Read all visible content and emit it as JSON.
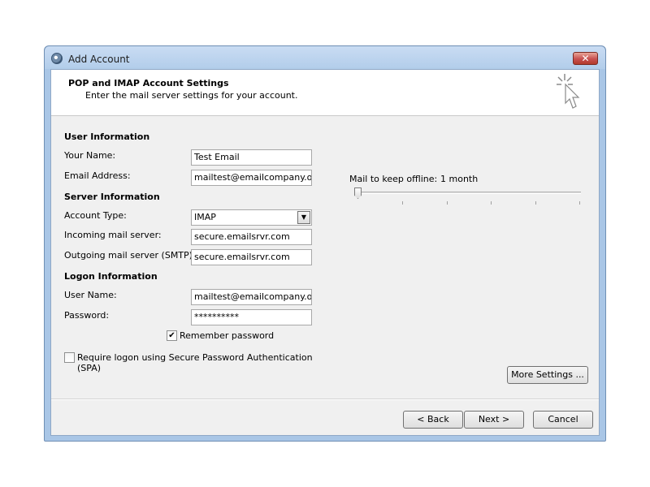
{
  "window": {
    "title": "Add Account",
    "close_glyph": "✕"
  },
  "header": {
    "title": "POP and IMAP Account Settings",
    "subtitle": "Enter the mail server settings for your account.",
    "icon": "cursor-sparkle-icon"
  },
  "user_info": {
    "heading": "User Information",
    "name_label": "Your Name:",
    "name_value": "Test Email",
    "email_label": "Email Address:",
    "email_value": "mailtest@emailcompany.org"
  },
  "server_info": {
    "heading": "Server Information",
    "account_type_label": "Account Type:",
    "account_type_value": "IMAP",
    "incoming_label": "Incoming mail server:",
    "incoming_value": "secure.emailsrvr.com",
    "outgoing_label": "Outgoing mail server (SMTP):",
    "outgoing_value": "secure.emailsrvr.com"
  },
  "logon_info": {
    "heading": "Logon Information",
    "username_label": "User Name:",
    "username_value": "mailtest@emailcompany.org",
    "password_label": "Password:",
    "password_value": "**********",
    "remember_label": "Remember password",
    "remember_checked": true,
    "spa_label_line1": "Require logon using Secure Password Authentication",
    "spa_label_line2": "(SPA)",
    "spa_checked": false
  },
  "offline": {
    "label": "Mail to keep offline:",
    "value": "1 month",
    "slider_position": 0
  },
  "buttons": {
    "more_settings": "More Settings ...",
    "back": "< Back",
    "next": "Next >",
    "cancel": "Cancel"
  }
}
